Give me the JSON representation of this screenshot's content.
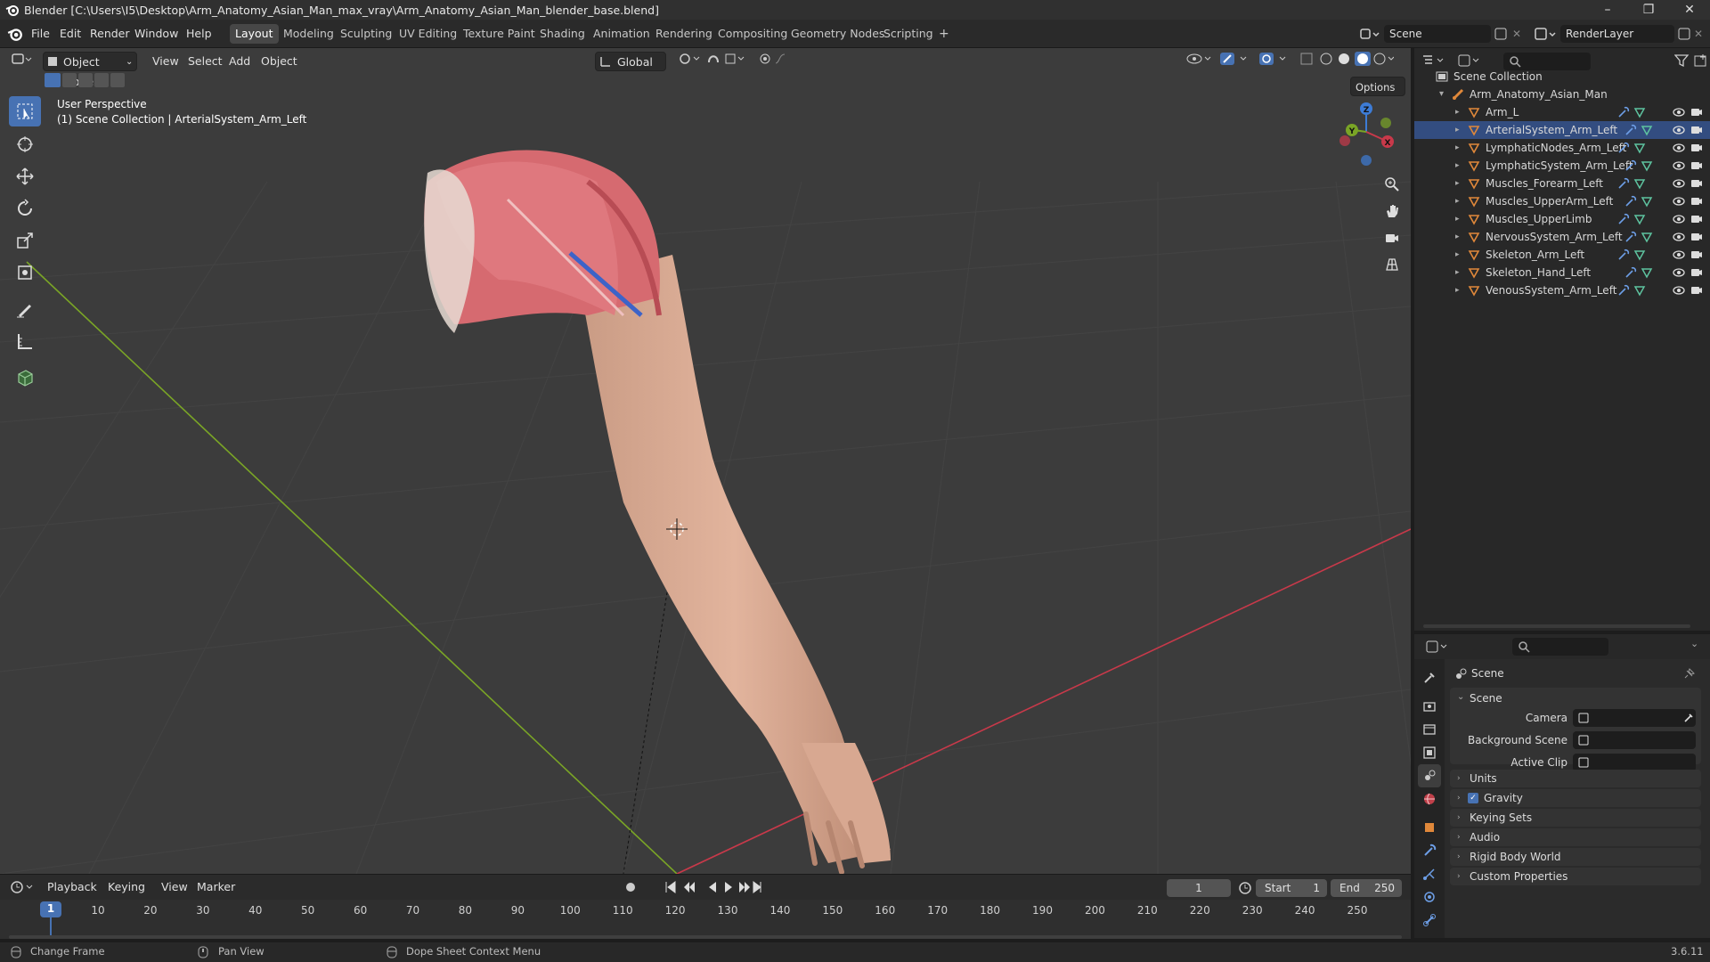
{
  "window": {
    "title": "Blender [C:\\Users\\I5\\Desktop\\Arm_Anatomy_Asian_Man_max_vray\\Arm_Anatomy_Asian_Man_blender_base.blend]",
    "controls": {
      "minimize": "–",
      "maximize": "❐",
      "close": "✕"
    }
  },
  "menus": [
    "File",
    "Edit",
    "Render",
    "Window",
    "Help"
  ],
  "workspaces": [
    "Layout",
    "Modeling",
    "Sculpting",
    "UV Editing",
    "Texture Paint",
    "Shading",
    "Animation",
    "Rendering",
    "Compositing",
    "Geometry Nodes",
    "Scripting"
  ],
  "active_workspace": "Layout",
  "add_workspace": "+",
  "scene_field": "Scene",
  "view_layer_field": "RenderLayer",
  "viewport": {
    "mode": "Object Mode",
    "menus": [
      "View",
      "Select",
      "Add",
      "Object"
    ],
    "orientation": "Global",
    "options_label": "Options",
    "overlay_line1": "User Perspective",
    "overlay_line2": "(1) Scene Collection | ArterialSystem_Arm_Left",
    "gizmo_labels": {
      "x": "X",
      "y": "Y",
      "z": "Z"
    }
  },
  "tools": [
    "select-box-icon",
    "cursor-icon",
    "move-icon",
    "rotate-icon",
    "scale-icon",
    "transform-icon",
    "annotate-icon",
    "measure-icon",
    "add-cube-icon"
  ],
  "outliner": {
    "root": "Scene Collection",
    "collection": "Arm_Anatomy_Asian_Man",
    "items": [
      "Arm_L",
      "ArterialSystem_Arm_Left",
      "LymphaticNodes_Arm_Left",
      "LymphaticSystem_Arm_Left",
      "Muscles_Forearm_Left",
      "Muscles_UpperArm_Left",
      "Muscles_UpperLimb",
      "NervousSystem_Arm_Left",
      "Skeleton_Arm_Left",
      "Skeleton_Hand_Left",
      "VenousSystem_Arm_Left"
    ],
    "active_item": "ArterialSystem_Arm_Left"
  },
  "properties": {
    "context": "Scene",
    "section": "Scene",
    "fields": [
      {
        "label": "Camera",
        "value": ""
      },
      {
        "label": "Background Scene",
        "value": ""
      },
      {
        "label": "Active Clip",
        "value": ""
      }
    ],
    "panels": [
      "Units",
      "Gravity",
      "Keying Sets",
      "Audio",
      "Rigid Body World",
      "Custom Properties"
    ],
    "gravity_checked": true
  },
  "timeline": {
    "menus": [
      "Playback",
      "Keying",
      "View",
      "Marker"
    ],
    "current_frame": "1",
    "start_label": "Start",
    "start": "1",
    "end_label": "End",
    "end": "250",
    "ticks": [
      "1",
      "10",
      "20",
      "30",
      "40",
      "50",
      "60",
      "70",
      "80",
      "90",
      "100",
      "110",
      "120",
      "130",
      "140",
      "150",
      "160",
      "170",
      "180",
      "190",
      "200",
      "210",
      "220",
      "230",
      "240",
      "250"
    ]
  },
  "statusbar": {
    "items": [
      "Change Frame",
      "Pan View",
      "Dope Sheet Context Menu"
    ],
    "version": "3.6.11"
  },
  "colors": {
    "accent": "#4772b3",
    "x_axis": "#c8394a",
    "y_axis": "#7aa526",
    "z_axis": "#3d7cd6",
    "object_icon": "#e0883a"
  }
}
